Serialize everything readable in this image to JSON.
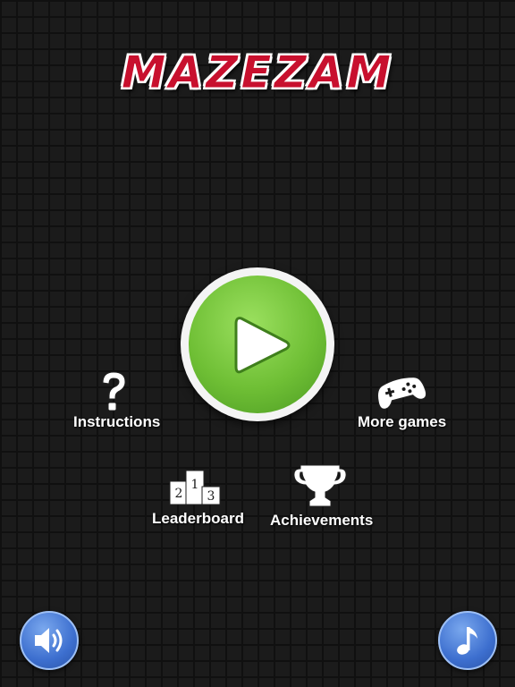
{
  "title": "MAZEZAM",
  "play": {
    "icon": "play-icon"
  },
  "menu": {
    "instructions": {
      "label": "Instructions",
      "icon": "question-mark-icon"
    },
    "more_games": {
      "label": "More games",
      "icon": "gamepad-icon"
    },
    "leaderboard": {
      "label": "Leaderboard",
      "icon": "podium-icon",
      "podium_numbers": [
        "2",
        "1",
        "3"
      ]
    },
    "achievements": {
      "label": "Achievements",
      "icon": "trophy-icon"
    }
  },
  "controls": {
    "sound": {
      "icon": "speaker-icon"
    },
    "music": {
      "icon": "music-note-icon"
    }
  },
  "colors": {
    "title_red": "#c8102e",
    "play_green": "#6fbf35",
    "round_button_blue": "#3d6fcf"
  }
}
